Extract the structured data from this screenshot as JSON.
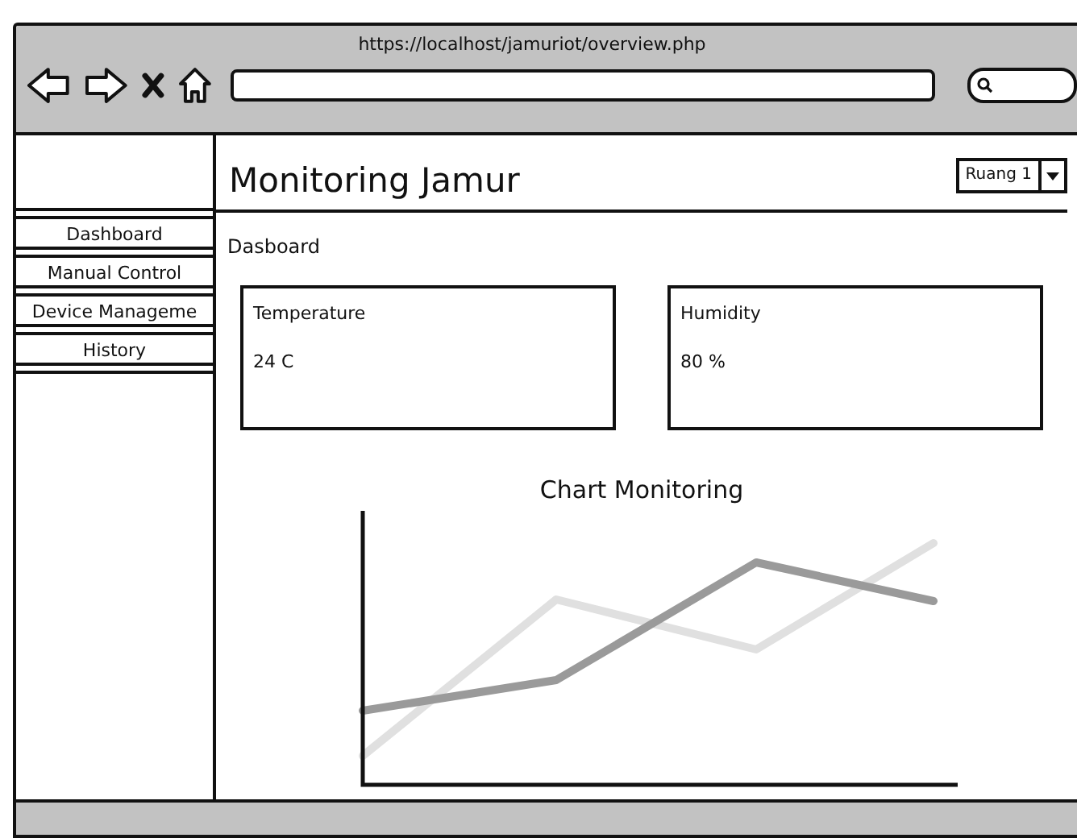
{
  "browser": {
    "url": "https://localhost/jamuriot/overview.php"
  },
  "header": {
    "title": "Monitoring Jamur",
    "room_select": {
      "value": "Ruang 1"
    }
  },
  "sidebar": {
    "items": [
      {
        "label": "Dashboard"
      },
      {
        "label": "Manual Control"
      },
      {
        "label": "Device Manageme"
      },
      {
        "label": "History"
      }
    ]
  },
  "page": {
    "heading": "Dasboard"
  },
  "cards": [
    {
      "label": "Temperature",
      "value": "24 C"
    },
    {
      "label": "Humidity",
      "value": "80 %"
    }
  ],
  "chart": {
    "title": "Chart Monitoring"
  }
}
